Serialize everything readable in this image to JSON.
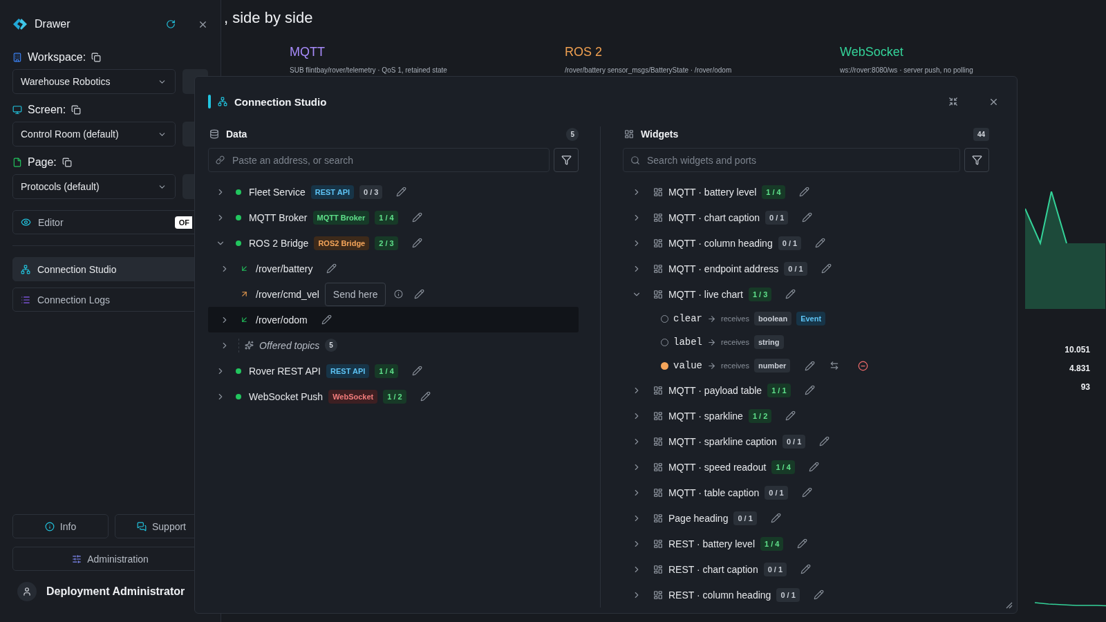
{
  "sidebar": {
    "title": "Drawer",
    "selectors": [
      {
        "kind": "workspace",
        "label": "Workspace:",
        "value": "Warehouse Robotics"
      },
      {
        "kind": "screen",
        "label": "Screen:",
        "value": "Control Room (default)"
      },
      {
        "kind": "page",
        "label": "Page:",
        "value": "Protocols (default)"
      }
    ],
    "editor": {
      "label": "Editor",
      "toggle": "OF",
      "on": false
    },
    "nav": [
      {
        "kind": "studio",
        "label": "Connection Studio",
        "selected": true
      },
      {
        "kind": "logs",
        "label": "Connection Logs",
        "selected": false
      }
    ],
    "footer_buttons": [
      {
        "kind": "info",
        "label": "Info"
      },
      {
        "kind": "support",
        "label": "Support"
      }
    ],
    "admin_button": "Administration",
    "user": "Deployment Administrator"
  },
  "page": {
    "title": ", side by side",
    "protocols": [
      {
        "name": "MQTT",
        "color": "#a78bfa",
        "detail": "SUB flintbay/rover/telemetry · QoS 1, retained state"
      },
      {
        "name": "ROS 2",
        "color": "#f0a050",
        "detail": "/rover/battery sensor_msgs/BatteryState · /rover/odom"
      },
      {
        "name": "WebSocket",
        "color": "#34d399",
        "detail": "ws://rover:8080/ws · server push, no polling"
      }
    ],
    "readings": [
      "10.051",
      "4.831",
      "93"
    ]
  },
  "dialog": {
    "title": "Connection Studio",
    "data": {
      "title": "Data",
      "count": "5",
      "search": {
        "placeholder": "Paste an address, or search"
      },
      "sources": [
        {
          "name": "Fleet Service",
          "online": true,
          "tag": {
            "label": "REST API",
            "kind": "rest"
          },
          "count": "0 / 3",
          "linked": false,
          "expanded": false
        },
        {
          "name": "MQTT Broker",
          "online": true,
          "tag": {
            "label": "MQTT Broker",
            "kind": "mqtt"
          },
          "count": "1 / 4",
          "linked": true,
          "expanded": false
        },
        {
          "name": "ROS 2 Bridge",
          "online": true,
          "tag": {
            "label": "ROS2 Bridge",
            "kind": "ros2"
          },
          "count": "2 / 3",
          "linked": true,
          "expanded": true,
          "children": [
            {
              "kind": "inbound",
              "name": "/rover/battery",
              "expandable": true,
              "selected": false
            },
            {
              "kind": "outbound",
              "name": "/rover/cmd_vel",
              "expandable": false,
              "action": "Send here",
              "selected": false
            },
            {
              "kind": "inbound",
              "name": "/rover/odom",
              "expandable": true,
              "selected": true
            },
            {
              "kind": "offered",
              "name": "Offered topics",
              "count": "5",
              "expandable": true,
              "selected": false
            }
          ]
        },
        {
          "name": "Rover REST API",
          "online": true,
          "tag": {
            "label": "REST API",
            "kind": "rest"
          },
          "count": "1 / 4",
          "linked": true,
          "expanded": false
        },
        {
          "name": "WebSocket Push",
          "online": true,
          "tag": {
            "label": "WebSocket",
            "kind": "websocket"
          },
          "count": "1 / 2",
          "linked": true,
          "expanded": false
        }
      ]
    },
    "widgets": {
      "title": "Widgets",
      "count": "44",
      "search": {
        "placeholder": "Search widgets and ports"
      },
      "items": [
        {
          "name": "MQTT · battery level",
          "count": "1 / 4",
          "linked": true,
          "expanded": false
        },
        {
          "name": "MQTT · chart caption",
          "count": "0 / 1",
          "linked": false,
          "expanded": false
        },
        {
          "name": "MQTT · column heading",
          "count": "0 / 1",
          "linked": false,
          "expanded": false
        },
        {
          "name": "MQTT · endpoint address",
          "count": "0 / 1",
          "linked": false,
          "expanded": false
        },
        {
          "name": "MQTT · live chart",
          "count": "1 / 3",
          "linked": true,
          "expanded": true,
          "ports": [
            {
              "name": "clear",
              "verb": "receives",
              "connected": false,
              "types": [
                {
                  "kind": "type",
                  "label": "boolean"
                },
                {
                  "kind": "event",
                  "label": "Event"
                }
              ]
            },
            {
              "name": "label",
              "verb": "receives",
              "connected": false,
              "types": [
                {
                  "kind": "type",
                  "label": "string"
                }
              ]
            },
            {
              "name": "value",
              "verb": "receives",
              "connected": true,
              "types": [
                {
                  "kind": "type",
                  "label": "number"
                }
              ]
            }
          ]
        },
        {
          "name": "MQTT · payload table",
          "count": "1 / 1",
          "linked": true,
          "expanded": false
        },
        {
          "name": "MQTT · sparkline",
          "count": "1 / 2",
          "linked": true,
          "expanded": false
        },
        {
          "name": "MQTT · sparkline caption",
          "count": "0 / 1",
          "linked": false,
          "expanded": false
        },
        {
          "name": "MQTT · speed readout",
          "count": "1 / 4",
          "linked": true,
          "expanded": false
        },
        {
          "name": "MQTT · table caption",
          "count": "0 / 1",
          "linked": false,
          "expanded": false
        },
        {
          "name": "Page heading",
          "count": "0 / 1",
          "linked": false,
          "expanded": false
        },
        {
          "name": "REST · battery level",
          "count": "1 / 4",
          "linked": true,
          "expanded": false
        },
        {
          "name": "REST · chart caption",
          "count": "0 / 1",
          "linked": false,
          "expanded": false
        },
        {
          "name": "REST · column heading",
          "count": "0 / 1",
          "linked": false,
          "expanded": false
        }
      ]
    }
  }
}
